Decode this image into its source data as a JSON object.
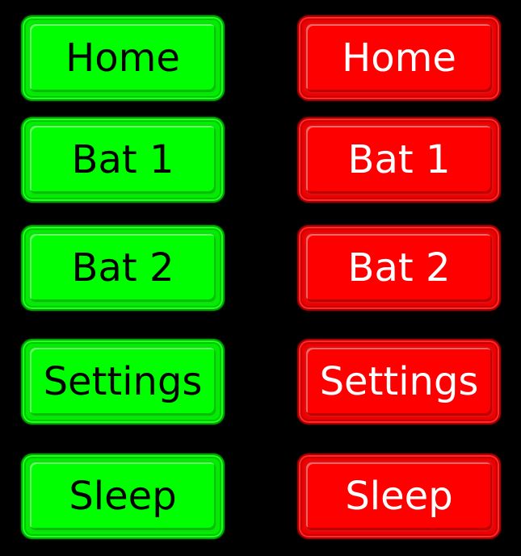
{
  "colors": {
    "background": "#000000",
    "green_button": "#00ff00",
    "green_text": "#000000",
    "red_button": "#ff0000",
    "red_text": "#ffffff"
  },
  "green_buttons": [
    {
      "label": "Home"
    },
    {
      "label": "Bat 1"
    },
    {
      "label": "Bat 2"
    },
    {
      "label": "Settings"
    },
    {
      "label": "Sleep"
    }
  ],
  "red_buttons": [
    {
      "label": "Home"
    },
    {
      "label": "Bat 1"
    },
    {
      "label": "Bat 2"
    },
    {
      "label": "Settings"
    },
    {
      "label": "Sleep"
    }
  ]
}
